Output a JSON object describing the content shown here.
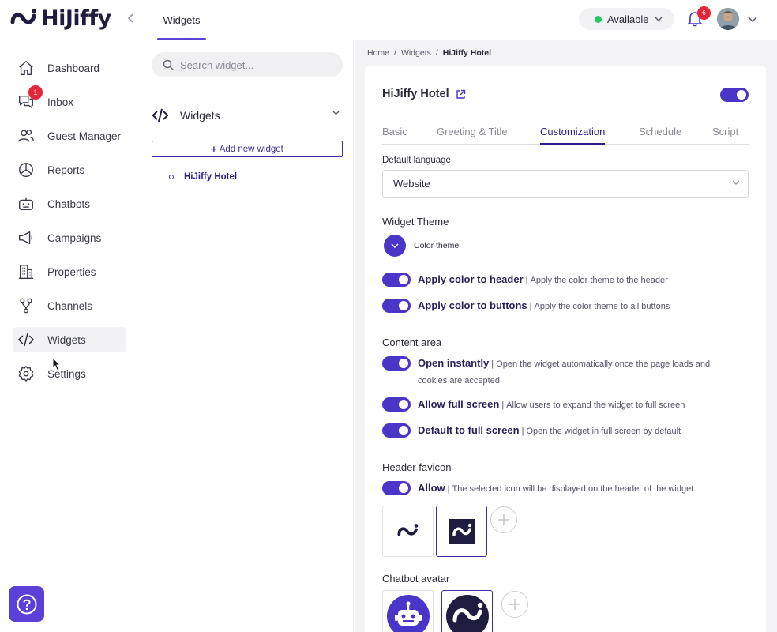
{
  "brand": {
    "name": "HiJiffy"
  },
  "sidebar": {
    "items": [
      {
        "label": "Dashboard"
      },
      {
        "label": "Inbox",
        "badge": "1"
      },
      {
        "label": "Guest Manager"
      },
      {
        "label": "Reports"
      },
      {
        "label": "Chatbots"
      },
      {
        "label": "Campaigns"
      },
      {
        "label": "Properties"
      },
      {
        "label": "Channels"
      },
      {
        "label": "Widgets"
      },
      {
        "label": "Settings"
      }
    ]
  },
  "topbar": {
    "tab": "Widgets",
    "status": "Available",
    "status_color": "#29c56a",
    "notifications": "6"
  },
  "panel": {
    "search_placeholder": "Search widget...",
    "group_title": "Widgets",
    "add_label": "Add new widget",
    "items": [
      {
        "label": "HiJiffy Hotel"
      }
    ]
  },
  "breadcrumb": {
    "home": "Home",
    "section": "Widgets",
    "current": "HiJiffy Hotel"
  },
  "card": {
    "title": "HiJiffy Hotel",
    "tabs": [
      {
        "label": "Basic"
      },
      {
        "label": "Greeting & Title"
      },
      {
        "label": "Customization"
      },
      {
        "label": "Schedule"
      },
      {
        "label": "Script"
      }
    ],
    "default_language": {
      "label": "Default language",
      "value": "Website"
    },
    "widget_theme": {
      "title": "Widget Theme",
      "color_theme_label": "Color theme",
      "options": [
        {
          "title": "Apply color to header",
          "desc": "Apply the color theme to the header"
        },
        {
          "title": "Apply color to buttons",
          "desc": "Apply the color theme to all buttons"
        }
      ]
    },
    "content_area": {
      "title": "Content area",
      "options": [
        {
          "title": "Open instantly",
          "desc": "Open the widget automatically once the page loads and cookies are accepted."
        },
        {
          "title": "Allow full screen",
          "desc": "Allow users to expand the widget to full screen"
        },
        {
          "title": "Default to full screen",
          "desc": "Open the widget in full screen by default"
        }
      ]
    },
    "header_favicon": {
      "title": "Header favicon",
      "option": {
        "title": "Allow",
        "desc": "The selected icon will be displayed on the header of the widget."
      }
    },
    "chatbot_avatar": {
      "title": "Chatbot avatar"
    }
  },
  "colors": {
    "accent": "#4a35c9",
    "accent_dark": "#2a1f8a",
    "help": "#5b40d8",
    "badge": "#e5253a",
    "brand_dark": "#1f1d3f"
  }
}
